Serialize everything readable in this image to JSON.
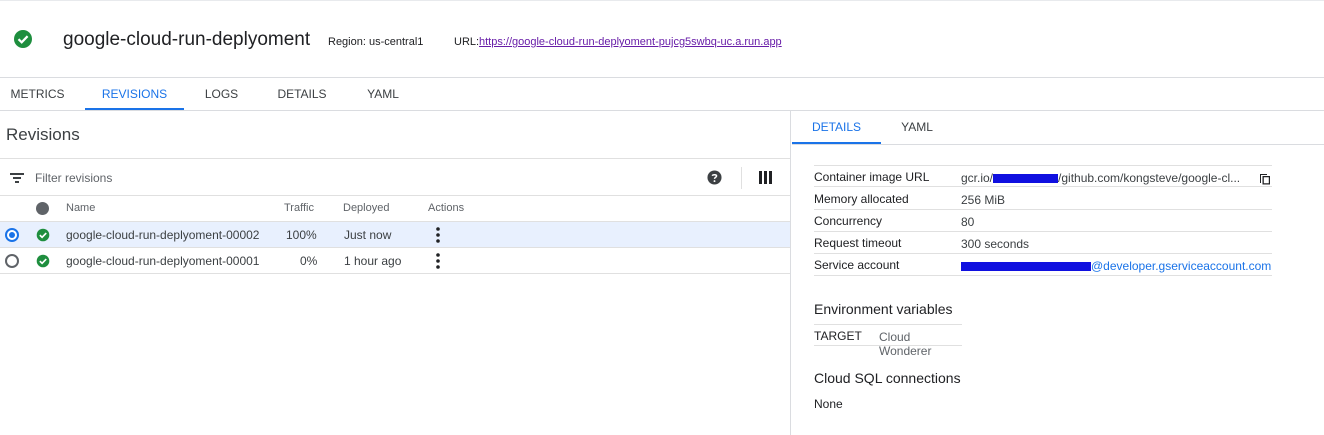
{
  "header": {
    "service_name": "google-cloud-run-deplyoment",
    "region": "Region: us-central1",
    "url_label": "URL:",
    "url": "https://google-cloud-run-deplyoment-pujcg5swbq-uc.a.run.app"
  },
  "main_tabs": [
    "METRICS",
    "REVISIONS",
    "LOGS",
    "DETAILS",
    "YAML"
  ],
  "revisions": {
    "title": "Revisions",
    "filter_placeholder": "Filter revisions",
    "columns": {
      "name": "Name",
      "traffic": "Traffic",
      "deployed": "Deployed",
      "actions": "Actions"
    },
    "rows": [
      {
        "name": "google-cloud-run-deplyoment-00002",
        "traffic": "100%",
        "deployed": "Just now",
        "selected": true
      },
      {
        "name": "google-cloud-run-deplyoment-00001",
        "traffic": "0%",
        "deployed": "1 hour ago",
        "selected": false
      }
    ]
  },
  "details_panel": {
    "tabs": [
      "DETAILS",
      "YAML"
    ],
    "fields": [
      {
        "key": "Container image URL",
        "value_prefix": "gcr.io/",
        "value_suffix": "/github.com/kongsteve/google-cl..."
      },
      {
        "key": "Memory allocated",
        "value": "256 MiB"
      },
      {
        "key": "Concurrency",
        "value": "80"
      },
      {
        "key": "Request timeout",
        "value": "300 seconds"
      },
      {
        "key": "Service account",
        "value_suffix": "@developer.gserviceaccount.com"
      }
    ],
    "env_title": "Environment variables",
    "env_vars": [
      {
        "key": "TARGET",
        "value": "Cloud Wonderer"
      }
    ],
    "sql_title": "Cloud SQL connections",
    "sql_value": "None"
  },
  "colors": {
    "accent": "#1a73e8",
    "success": "#1e8e3e",
    "link_visited": "#681da8",
    "redaction": "#1010e0"
  },
  "icons": [
    "check-circle-icon",
    "filter-icon",
    "help-icon",
    "columns-icon",
    "more-vert-icon",
    "copy-icon"
  ]
}
